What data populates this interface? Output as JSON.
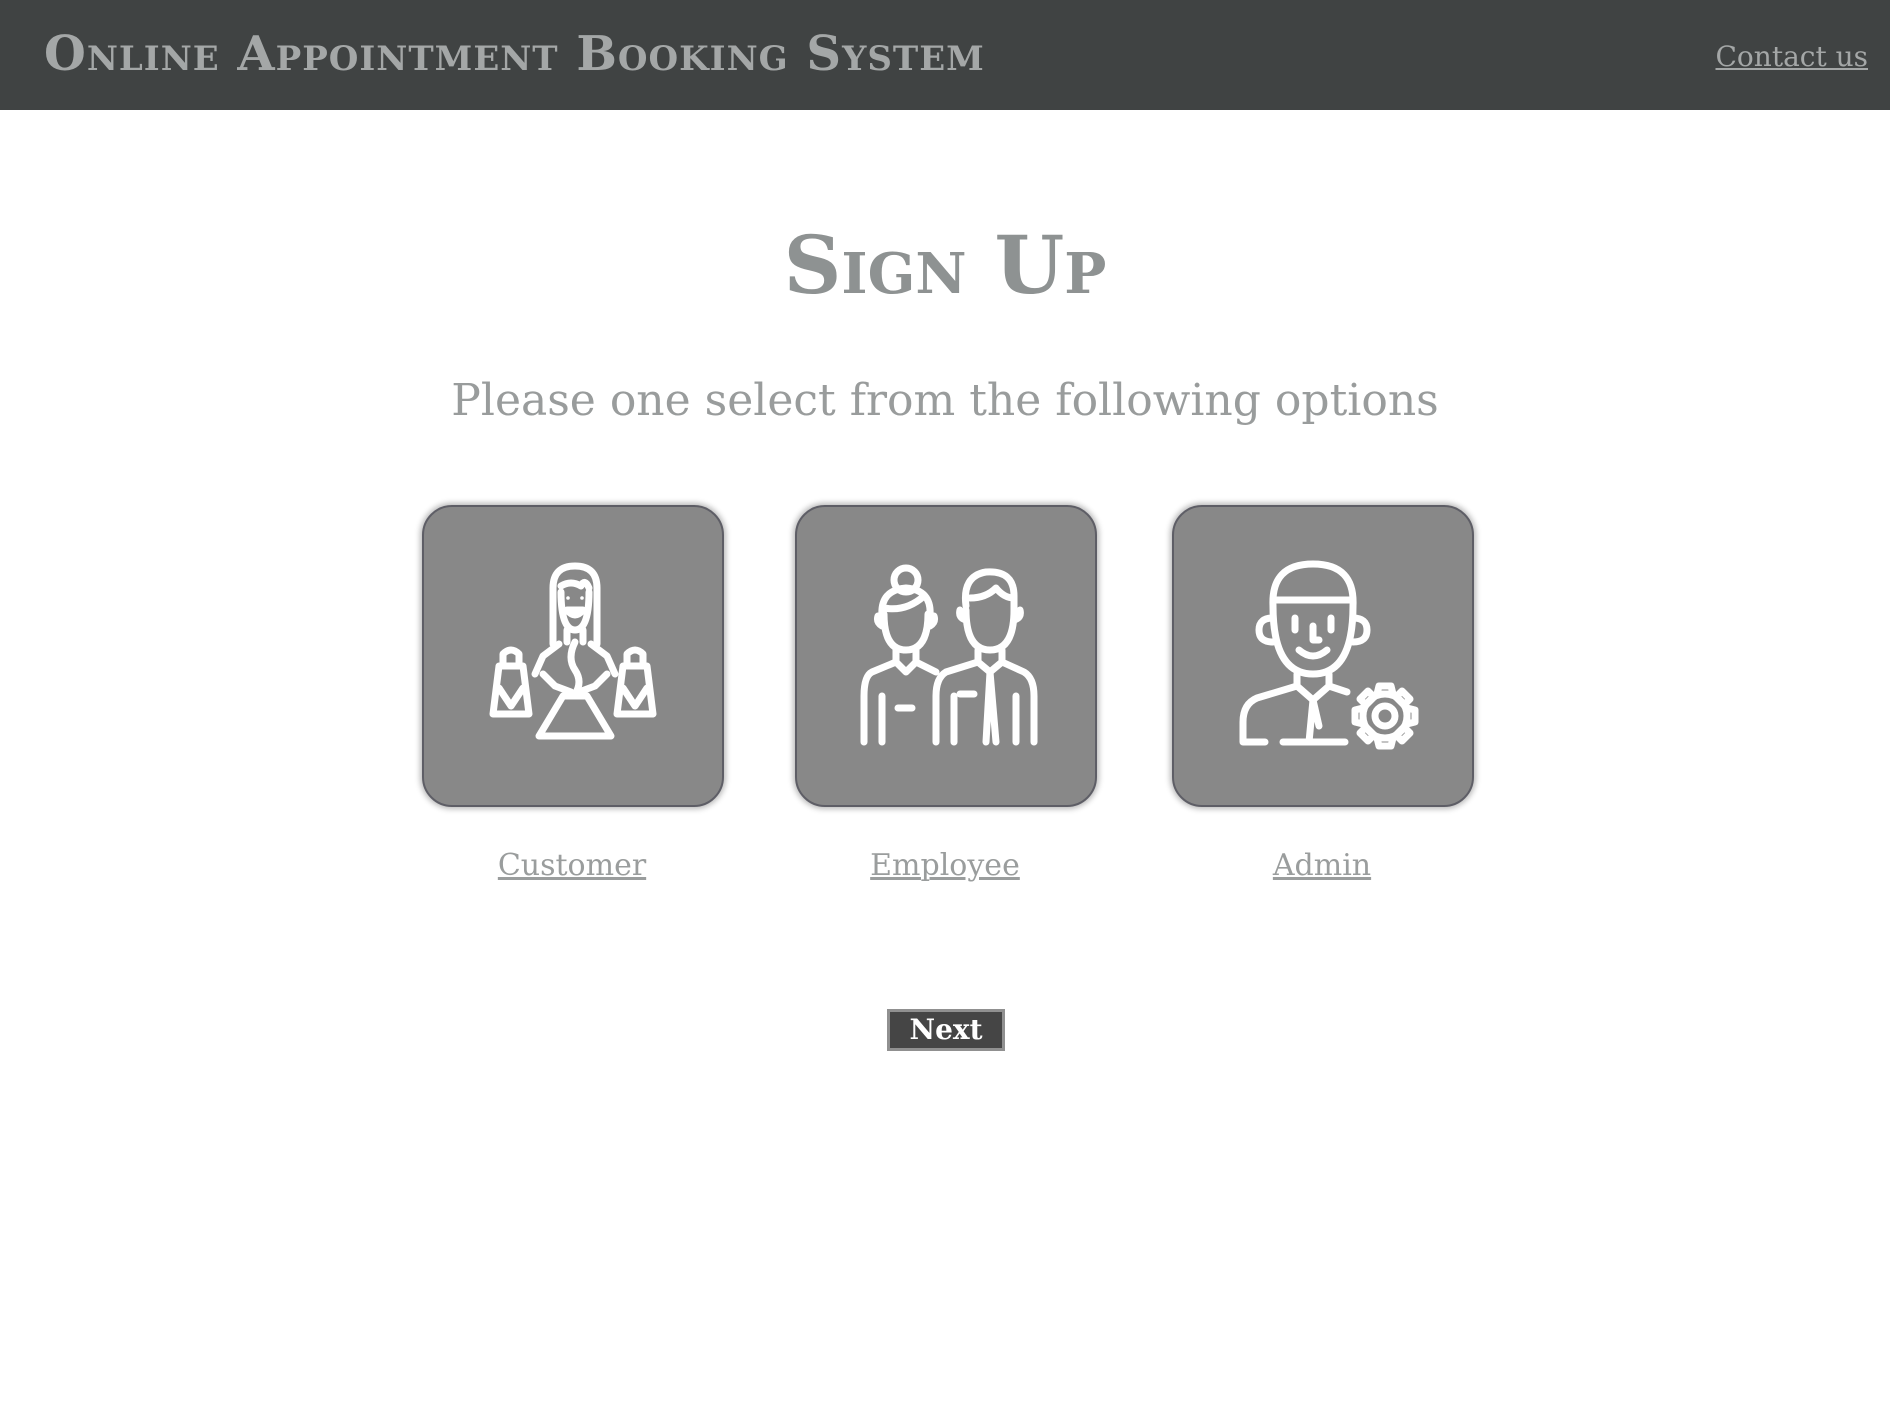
{
  "header": {
    "app_title": "Online Appointment Booking System",
    "contact_label": "Contact us"
  },
  "main": {
    "title": "Sign Up",
    "subtitle": "Please one select from the following options",
    "options": [
      {
        "label": "Customer",
        "icon": "customer-shopping-icon"
      },
      {
        "label": "Employee",
        "icon": "employees-icon"
      },
      {
        "label": "Admin",
        "icon": "admin-gear-icon"
      }
    ],
    "next_label": "Next"
  },
  "colors": {
    "header_bg": "#404343",
    "header_text": "#a4a7a7",
    "card_bg": "#888888",
    "card_border": "#5e5e66",
    "button_bg": "#454545",
    "button_border": "#909090",
    "heading_text": "#8e9292"
  }
}
